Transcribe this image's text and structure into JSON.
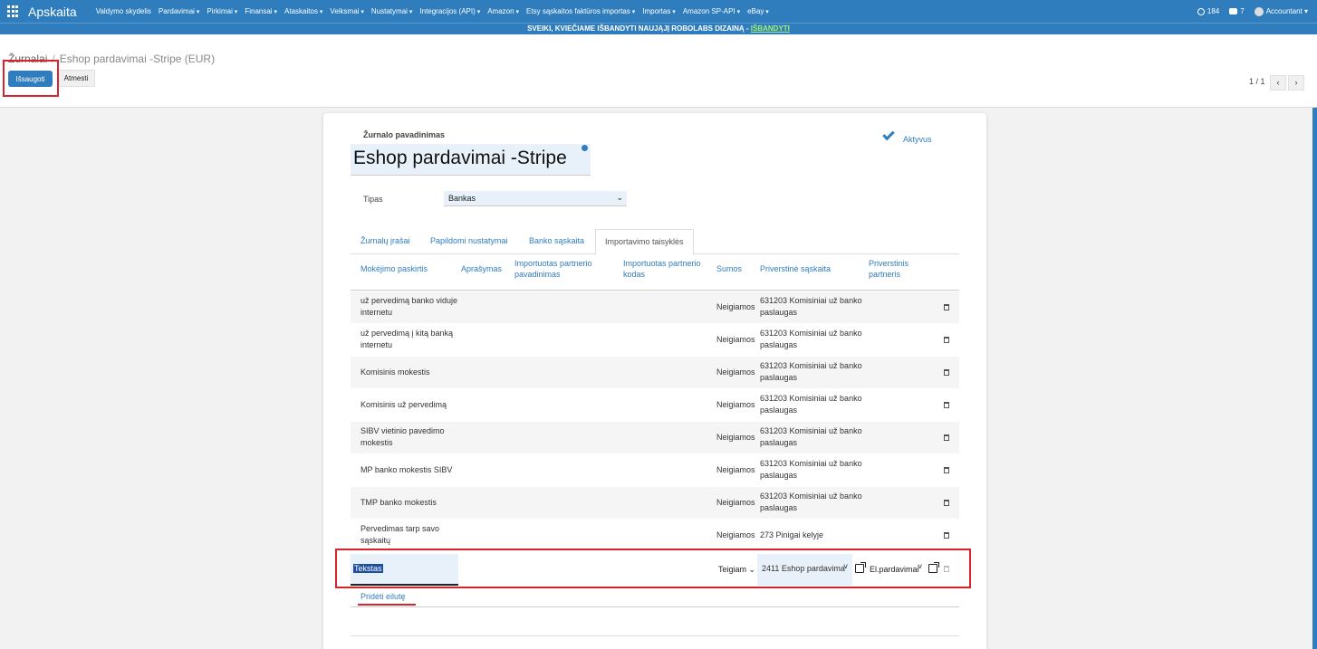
{
  "topnav": {
    "brand": "Apskaita",
    "menu": [
      "Valdymo skydelis",
      "Pardavimai",
      "Pirkimai",
      "Finansai",
      "Ataskaitos",
      "Veiksmai",
      "Nustatymai",
      "Integracijos (API)",
      "Amazon",
      "Etsy sąskaitos faktūros importas",
      "Importas",
      "Amazon SP-API",
      "eBay"
    ],
    "activity_count": "184",
    "messages_count": "7",
    "user": "Accountant"
  },
  "banner": {
    "text": "SVEIKI, KVIEČIAME IŠBANDYTI NAUJĄJĮ ROBOLABS DIZAINĄ -",
    "link": "IŠBANDYTI"
  },
  "control": {
    "breadcrumb_parent": "Žurnalai",
    "breadcrumb_separator": "/",
    "breadcrumb_current": "Eshop pardavimai -Stripe (EUR)",
    "save_label": "Išsaugoti",
    "discard_label": "Atmesti",
    "pager": "1 / 1",
    "prev": "‹",
    "next": "›"
  },
  "form": {
    "name_label": "Žurnalo pavadinimas",
    "name_value": "Eshop pardavimai -Stripe",
    "active_label": "Aktyvus",
    "type_label": "Tipas",
    "type_value": "Bankas",
    "type_chevron": "⌄"
  },
  "tabs": [
    "Žurnalų įrašai",
    "Papildomi nustatymai",
    "Banko sąskaita",
    "Importavimo taisyklės"
  ],
  "table": {
    "headers": {
      "payment_purpose": "Mokėjimo paskirtis",
      "description": "Aprašymas",
      "imported_partner_name_1": "Importuotas partnerio",
      "imported_partner_name_2": "pavadinimas",
      "imported_partner_code_1": "Importuotas partnerio",
      "imported_partner_code_2": "kodas",
      "amounts": "Sumos",
      "forced_account": "Priverstinė sąskaita",
      "forced_partner_1": "Priverstinis",
      "forced_partner_2": "partneris"
    },
    "rows": [
      {
        "purpose_1": "už pervedimą banko viduje",
        "purpose_2": "internetu",
        "amount": "Neigiamos",
        "account_1": "631203 Komisiniai už banko",
        "account_2": "paslaugas"
      },
      {
        "purpose_1": "už pervedimą į kitą banką",
        "purpose_2": "internetu",
        "amount": "Neigiamos",
        "account_1": "631203 Komisiniai už banko",
        "account_2": "paslaugas"
      },
      {
        "purpose_1": "Komisinis mokestis",
        "purpose_2": "",
        "amount": "Neigiamos",
        "account_1": "631203 Komisiniai už banko",
        "account_2": "paslaugas"
      },
      {
        "purpose_1": "Komisinis už pervedimą",
        "purpose_2": "",
        "amount": "Neigiamos",
        "account_1": "631203 Komisiniai už banko",
        "account_2": "paslaugas"
      },
      {
        "purpose_1": "SIBV vietinio pavedimo",
        "purpose_2": "mokestis",
        "amount": "Neigiamos",
        "account_1": "631203 Komisiniai už banko",
        "account_2": "paslaugas"
      },
      {
        "purpose_1": "MP banko mokestis SIBV",
        "purpose_2": "",
        "amount": "Neigiamos",
        "account_1": "631203 Komisiniai už banko",
        "account_2": "paslaugas"
      },
      {
        "purpose_1": "TMP banko mokestis",
        "purpose_2": "",
        "amount": "Neigiamos",
        "account_1": "631203 Komisiniai už banko",
        "account_2": "paslaugas"
      },
      {
        "purpose_1": "Pervedimas tarp savo",
        "purpose_2": "sąskaitų",
        "amount": "Neigiamos",
        "account_1": "273 Pinigai kelyje",
        "account_2": ""
      }
    ],
    "edit_row": {
      "purpose": "Tekstas",
      "amount": "Teigiam",
      "amount_chevron": "⌄",
      "account": "2411 Eshop pardavima",
      "account_caret": "˅",
      "partner": "El.pardavimai",
      "partner_caret": "˅"
    },
    "add_line": "Pridėti eilutę"
  }
}
